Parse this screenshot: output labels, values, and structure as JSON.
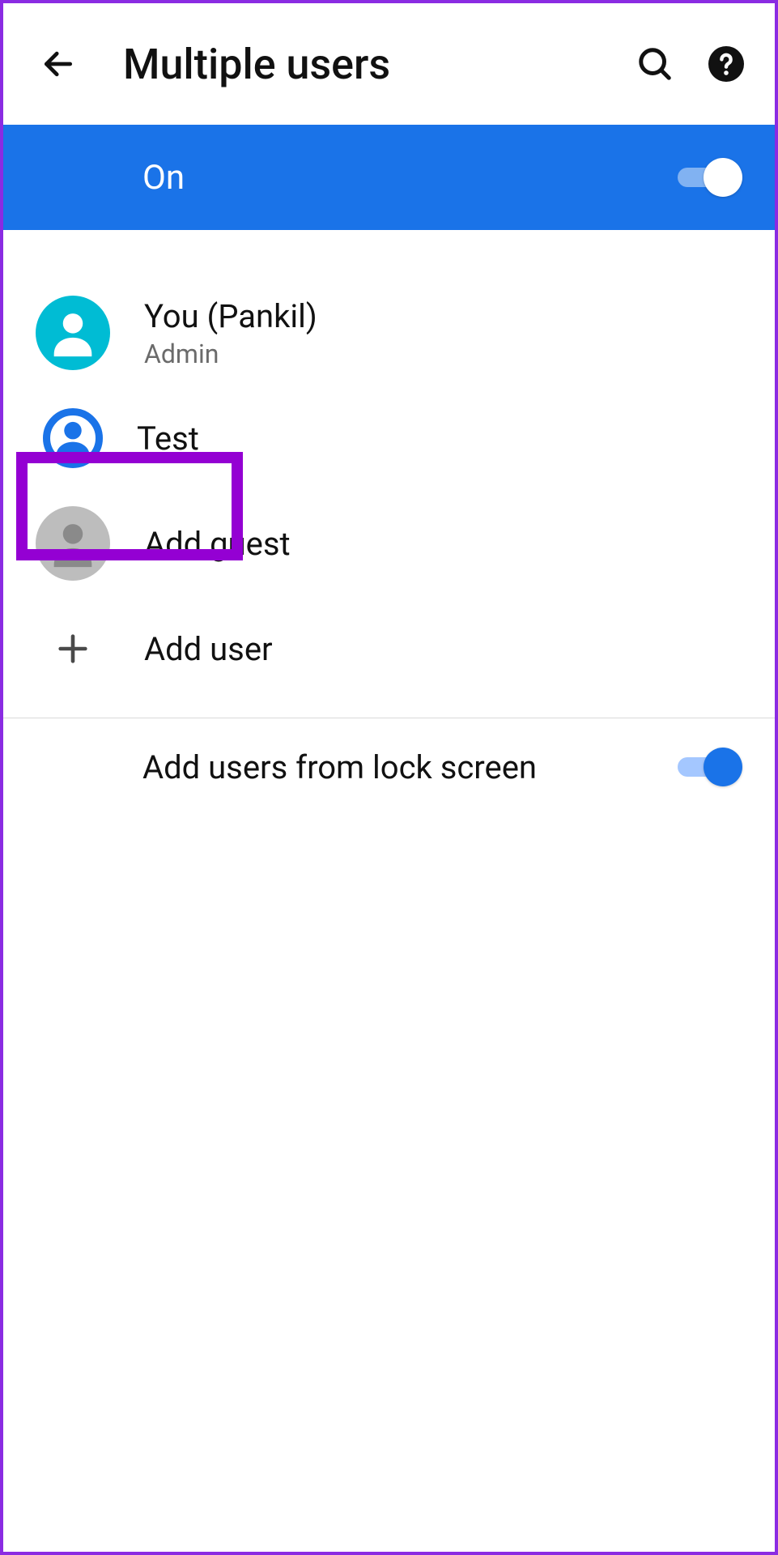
{
  "header": {
    "title": "Multiple users"
  },
  "banner": {
    "label": "On",
    "toggle_on": true
  },
  "users": {
    "you": {
      "name": "You (Pankil)",
      "role": "Admin"
    },
    "test": {
      "name": "Test"
    },
    "guest": {
      "label": "Add guest"
    },
    "add": {
      "label": "Add user"
    }
  },
  "lock_screen": {
    "label": "Add users from lock screen",
    "toggle_on": true
  }
}
